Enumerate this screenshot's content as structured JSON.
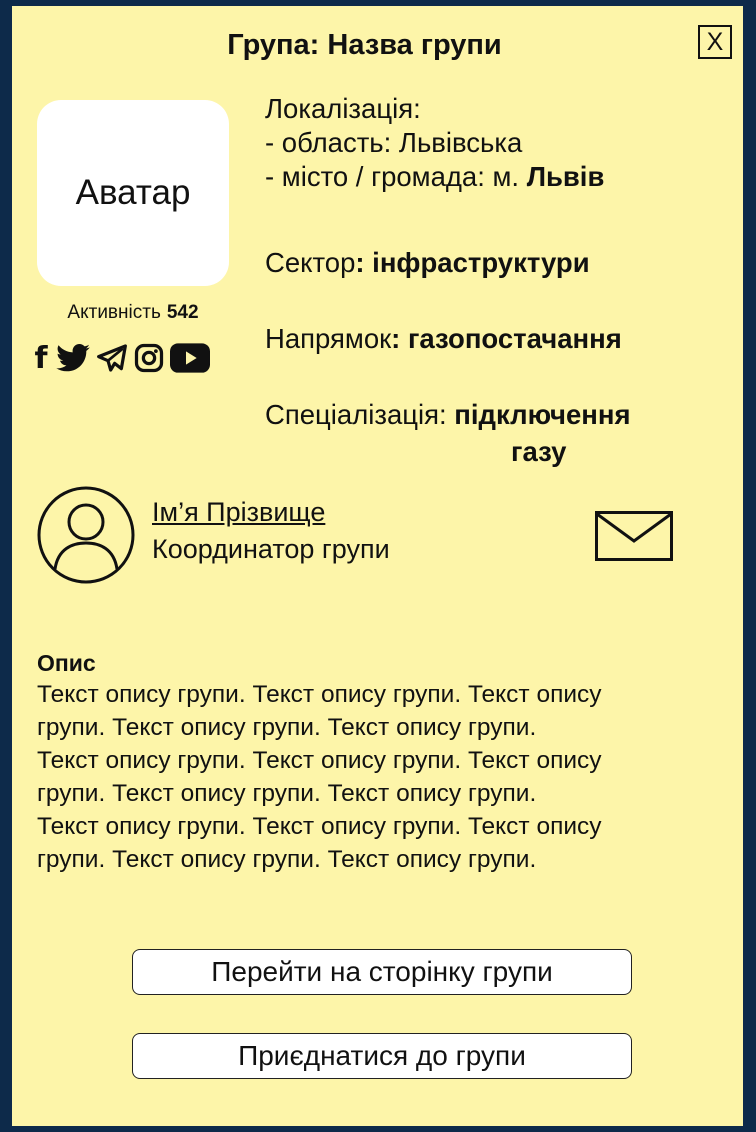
{
  "header": {
    "title": "Група: Назва групи",
    "close_label": "X"
  },
  "avatar": {
    "label": "Аватар"
  },
  "activity": {
    "label": "Активність",
    "value": "542"
  },
  "socials": [
    "facebook-icon",
    "twitter-icon",
    "telegram-icon",
    "instagram-icon",
    "youtube-icon"
  ],
  "location": {
    "heading": "Локалізація:",
    "region_label": "- область: Львівська",
    "city_prefix": "- місто / громада: м.",
    "city_value": "Львів"
  },
  "sector": {
    "label": "Сектор",
    "value": ": інфраструктури"
  },
  "direction": {
    "label": "Напрямок",
    "value": ": газопостачання"
  },
  "specialization": {
    "label": "Спеціалізація:",
    "value_line1": "підключення",
    "value_line2": "газу"
  },
  "coordinator": {
    "name": "Ім’я Прізвище",
    "role": "Координатор групи"
  },
  "description": {
    "heading": "Опис",
    "lines": [
      "Текст опису групи. Текст опису групи. Текст опису",
      "групи. Текст опису групи. Текст опису групи.",
      "Текст опису групи. Текст опису групи. Текст опису",
      "групи. Текст опису групи. Текст опису групи.",
      "Текст опису групи. Текст опису групи. Текст опису",
      "групи. Текст опису групи. Текст опису групи."
    ]
  },
  "buttons": {
    "go_to_group": "Перейти на сторінку групи",
    "join_group": "Приєднатися до групи"
  },
  "colors": {
    "card_background": "#fdf5a9",
    "page_background": "#0d2a4a",
    "avatar_background": "#ffffff"
  }
}
